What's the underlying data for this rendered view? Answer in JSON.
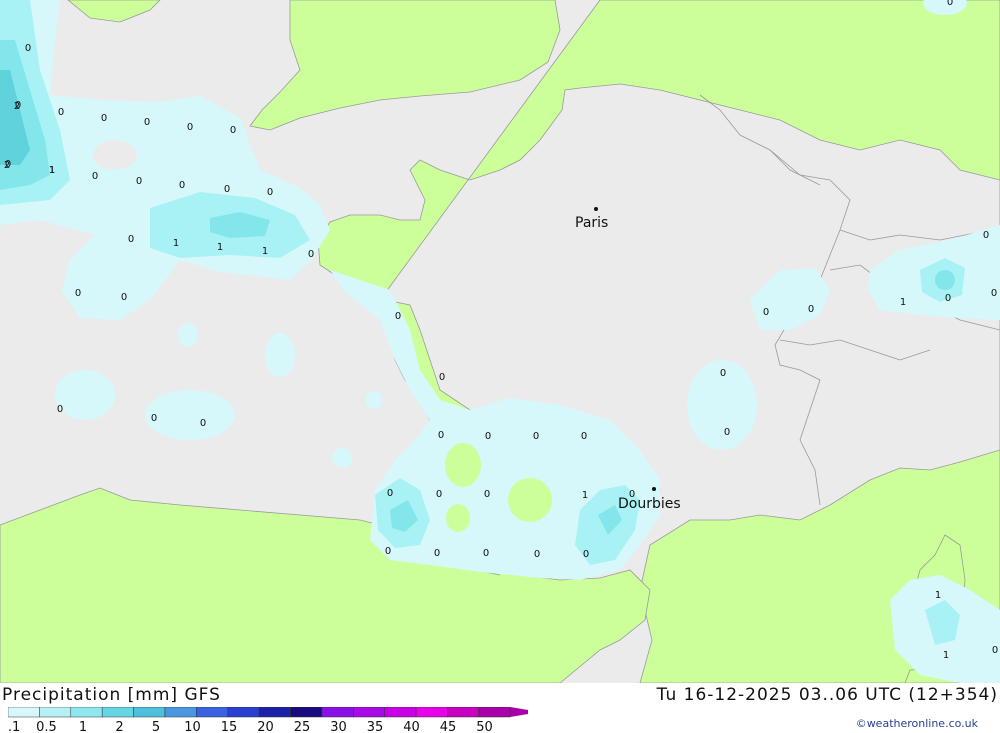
{
  "header": {
    "title": "Precipitation [mm] GFS",
    "datetime": "Tu 16-12-2025 03..06 UTC (12+354)",
    "credit": "©weatheronline.co.uk"
  },
  "colors": {
    "land": "#ccff99",
    "sea": "#ebebeb",
    "border": "#9a9a9a",
    "precip_light": "#d6f8fa",
    "precip_mid": "#a8f2f5",
    "precip_strong": "#82e6ea",
    "precip_heavy": "#5fd2dc"
  },
  "cities": [
    {
      "name": "Paris"
    },
    {
      "name": "Dourbies"
    }
  ],
  "legend": {
    "colors": [
      "#d6f8fa",
      "#b4f0f4",
      "#8ee6ee",
      "#66d6e4",
      "#4ec0dc",
      "#4a96e0",
      "#3a62e0",
      "#2a3ed0",
      "#1c22a8",
      "#1a0a80",
      "#8a10e8",
      "#a80ae8",
      "#c800e8",
      "#e800e8",
      "#c800c0",
      "#a800a8"
    ],
    "ticks": [
      "0.1",
      "0.5",
      "1",
      "2",
      "5",
      "10",
      "15",
      "20",
      "25",
      "30",
      "35",
      "40",
      "45",
      "50"
    ]
  },
  "labels": [
    "0",
    "2",
    "2",
    "1",
    "0",
    "0",
    "0",
    "0",
    "0",
    "0",
    "0",
    "0",
    "0",
    "0",
    "1",
    "1",
    "1",
    "0",
    "0",
    "0",
    "0",
    "0",
    "0",
    "0",
    "0",
    "0",
    "0",
    "0",
    "0",
    "0",
    "0",
    "0",
    "0",
    "1",
    "0",
    "0",
    "0",
    "0",
    "0",
    "0",
    "0",
    "0",
    "1",
    "0",
    "0",
    "0",
    "0",
    "0",
    "1",
    "1",
    "0",
    "0",
    "0",
    "0",
    "1"
  ]
}
